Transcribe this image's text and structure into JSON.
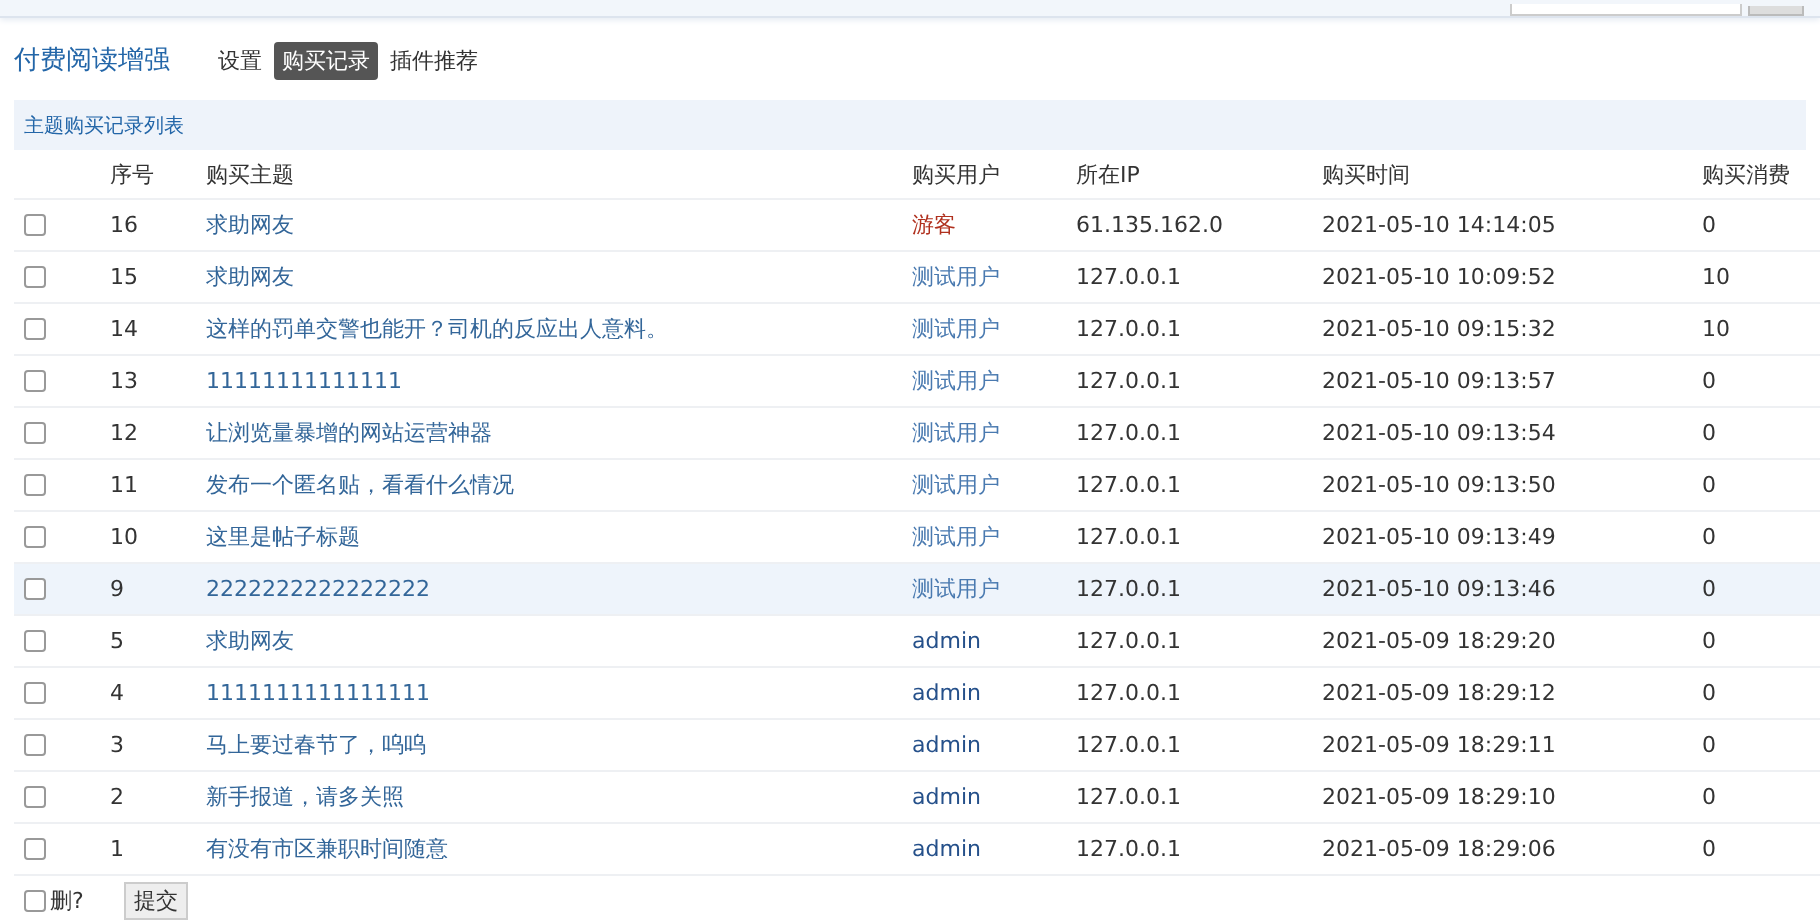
{
  "plugin": {
    "title": "付费阅读增强",
    "tabs": [
      {
        "label": "设置",
        "selected": false
      },
      {
        "label": "购买记录",
        "selected": true
      },
      {
        "label": "插件推荐",
        "selected": false
      }
    ]
  },
  "section_title": "主题购买记录列表",
  "table": {
    "columns": [
      "序号",
      "购买主题",
      "购买用户",
      "所在IP",
      "购买时间",
      "购买消费"
    ],
    "rows": [
      {
        "checked": false,
        "highlighted": false,
        "id": "16",
        "topic": "求助网友",
        "user": "游客",
        "color": "#b0301e",
        "ip": "61.135.162.0",
        "time": "2021-05-10 14:14:05",
        "cost": "0"
      },
      {
        "checked": false,
        "highlighted": false,
        "id": "15",
        "topic": "求助网友",
        "user": "测试用户",
        "color": "#4a7ab0",
        "ip": "127.0.0.1",
        "time": "2021-05-10 10:09:52",
        "cost": "10"
      },
      {
        "checked": false,
        "highlighted": false,
        "id": "14",
        "topic": "这样的罚单交警也能开？司机的反应出人意料。",
        "user": "测试用户",
        "color": "#4a7ab0",
        "ip": "127.0.0.1",
        "time": "2021-05-10 09:15:32",
        "cost": "10"
      },
      {
        "checked": false,
        "highlighted": false,
        "id": "13",
        "topic": "11111111111111",
        "user": "测试用户",
        "color": "#4a7ab0",
        "ip": "127.0.0.1",
        "time": "2021-05-10 09:13:57",
        "cost": "0"
      },
      {
        "checked": false,
        "highlighted": false,
        "id": "12",
        "topic": "让浏览量暴增的网站运营神器",
        "user": "测试用户",
        "color": "#4a7ab0",
        "ip": "127.0.0.1",
        "time": "2021-05-10 09:13:54",
        "cost": "0"
      },
      {
        "checked": false,
        "highlighted": false,
        "id": "11",
        "topic": "发布一个匿名贴，看看什么情况",
        "user": "测试用户",
        "color": "#4a7ab0",
        "ip": "127.0.0.1",
        "time": "2021-05-10 09:13:50",
        "cost": "0"
      },
      {
        "checked": false,
        "highlighted": false,
        "id": "10",
        "topic": "这里是帖子标题",
        "user": "测试用户",
        "color": "#4a7ab0",
        "ip": "127.0.0.1",
        "time": "2021-05-10 09:13:49",
        "cost": "0"
      },
      {
        "checked": false,
        "highlighted": true,
        "id": "9",
        "topic": "2222222222222222",
        "user": "测试用户",
        "color": "#4a7ab0",
        "ip": "127.0.0.1",
        "time": "2021-05-10 09:13:46",
        "cost": "0"
      },
      {
        "checked": false,
        "highlighted": false,
        "id": "5",
        "topic": "求助网友",
        "user": "admin",
        "color": "#25508a",
        "ip": "127.0.0.1",
        "time": "2021-05-09 18:29:20",
        "cost": "0"
      },
      {
        "checked": false,
        "highlighted": false,
        "id": "4",
        "topic": "1111111111111111",
        "user": "admin",
        "color": "#25508a",
        "ip": "127.0.0.1",
        "time": "2021-05-09 18:29:12",
        "cost": "0"
      },
      {
        "checked": false,
        "highlighted": false,
        "id": "3",
        "topic": "马上要过春节了，呜呜",
        "user": "admin",
        "color": "#25508a",
        "ip": "127.0.0.1",
        "time": "2021-05-09 18:29:11",
        "cost": "0"
      },
      {
        "checked": false,
        "highlighted": false,
        "id": "2",
        "topic": "新手报道，请多关照",
        "user": "admin",
        "color": "#25508a",
        "ip": "127.0.0.1",
        "time": "2021-05-09 18:29:10",
        "cost": "0"
      },
      {
        "checked": false,
        "highlighted": false,
        "id": "1",
        "topic": "有没有市区兼职时间随意",
        "user": "admin",
        "color": "#25508a",
        "ip": "127.0.0.1",
        "time": "2021-05-09 18:29:06",
        "cost": "0"
      }
    ]
  },
  "footer": {
    "delete_label": "删?",
    "delete_checked": false,
    "submit": "提交"
  }
}
